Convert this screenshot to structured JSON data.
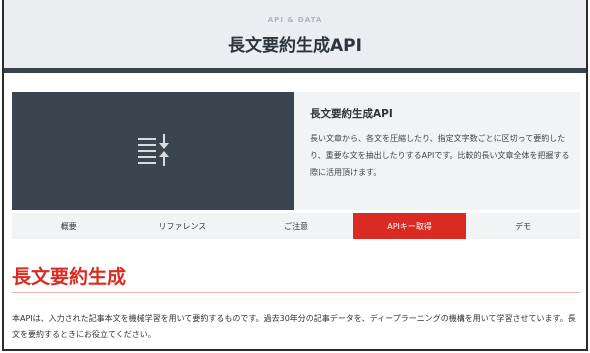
{
  "header": {
    "subtitle": "API & DATA",
    "title": "長文要約生成API"
  },
  "hero": {
    "icon": "sort-lines-icon",
    "title": "長文要約生成API",
    "description": "長い文章から、各文を圧縮したり、指定文字数ごとに区切って要約したり、重要な文を抽出したりするAPIです。比較的長い文章全体を把握する際に活用頂けます。"
  },
  "tabs": [
    {
      "label": "概要"
    },
    {
      "label": "リファレンス"
    },
    {
      "label": "ご注意"
    },
    {
      "label": "APIキー取得"
    },
    {
      "label": "デモ"
    }
  ],
  "section": {
    "title": "長文要約生成",
    "body": "本APIは、入力された記事本文を機械学習を用いて要約するものです。過去30年分の記事データを、ディープラーニングの機構を用いて学習させています。長文を要約するときにお役立てください。"
  },
  "colors": {
    "accent": "#d92b22",
    "dark": "#3b454f",
    "panel": "#f2f3f5"
  }
}
